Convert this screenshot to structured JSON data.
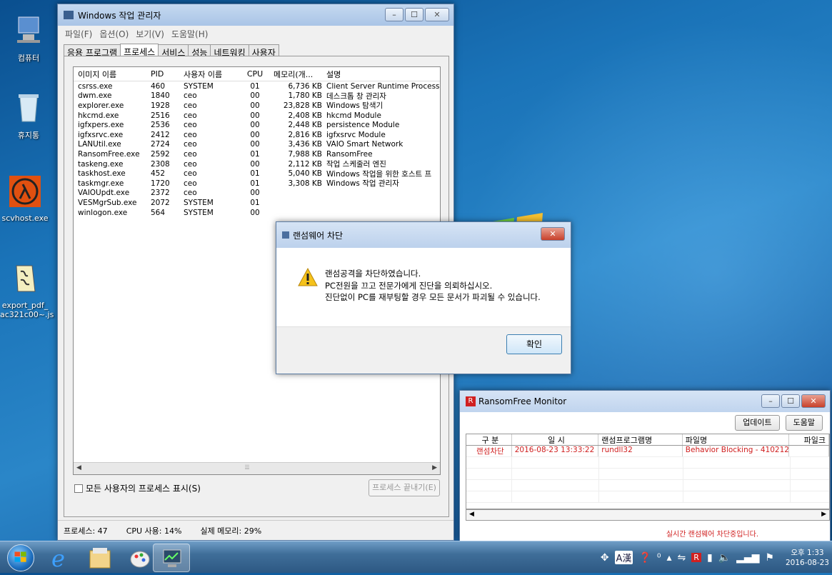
{
  "desktop": {
    "icons": [
      {
        "label": "컴퓨터",
        "icon": "computer-icon"
      },
      {
        "label": "휴지통",
        "icon": "recycle-bin-icon"
      },
      {
        "label": "scvhost.exe",
        "icon": "half-life-lambda-icon"
      },
      {
        "label": "export_pdf_\nac321c00~.js",
        "icon": "script-file-icon"
      }
    ]
  },
  "taskmgr": {
    "title": "Windows 작업 관리자",
    "menu": [
      "파일(F)",
      "옵션(O)",
      "보기(V)",
      "도움말(H)"
    ],
    "tabs": [
      "응용 프로그램",
      "프로세스",
      "서비스",
      "성능",
      "네트워킹",
      "사용자"
    ],
    "columns": [
      "이미지 이름",
      "PID",
      "사용자 이름",
      "CPU",
      "메모리(개...",
      "설명"
    ],
    "rows": [
      [
        "csrss.exe",
        "460",
        "SYSTEM",
        "01",
        "6,736 KB",
        "Client Server Runtime Process"
      ],
      [
        "dwm.exe",
        "1840",
        "ceo",
        "00",
        "1,780 KB",
        "데스크톱 창 관리자"
      ],
      [
        "explorer.exe",
        "1928",
        "ceo",
        "00",
        "23,828 KB",
        "Windows 탐색기"
      ],
      [
        "hkcmd.exe",
        "2516",
        "ceo",
        "00",
        "2,408 KB",
        "hkcmd Module"
      ],
      [
        "igfxpers.exe",
        "2536",
        "ceo",
        "00",
        "2,448 KB",
        "persistence Module"
      ],
      [
        "igfxsrvc.exe",
        "2412",
        "ceo",
        "00",
        "2,816 KB",
        "igfxsrvc Module"
      ],
      [
        "LANUtil.exe",
        "2724",
        "ceo",
        "00",
        "3,436 KB",
        "VAIO Smart Network"
      ],
      [
        "RansomFree.exe",
        "2592",
        "ceo",
        "01",
        "7,988 KB",
        "RansomFree"
      ],
      [
        "taskeng.exe",
        "2308",
        "ceo",
        "00",
        "2,112 KB",
        "작업 스케줄러 엔진"
      ],
      [
        "taskhost.exe",
        "452",
        "ceo",
        "01",
        "5,040 KB",
        "Windows 작업을 위한 호스트 프"
      ],
      [
        "taskmgr.exe",
        "1720",
        "ceo",
        "01",
        "3,308 KB",
        "Windows 작업 관리자"
      ],
      [
        "VAIOUpdt.exe",
        "2372",
        "ceo",
        "00",
        "",
        ""
      ],
      [
        "VESMgrSub.exe",
        "2072",
        "SYSTEM",
        "01",
        "",
        ""
      ],
      [
        "winlogon.exe",
        "564",
        "SYSTEM",
        "00",
        "",
        ""
      ]
    ],
    "show_all_label": "모든 사용자의 프로세스 표시(S)",
    "end_process_label": "프로세스 끝내기(E)",
    "status": {
      "processes": "프로세스: 47",
      "cpu": "CPU 사용: 14%",
      "memory": "실제 메모리: 29%"
    }
  },
  "dialog": {
    "title": "랜섬웨어 차단",
    "lines": [
      "랜섬공격을 차단하였습니다.",
      "PC전원을 끄고 전문가에게 진단을 의뢰하십시오.",
      "진단없이 PC를 재부팅할 경우 모든 문서가 파괴될 수 있습니다."
    ],
    "ok_label": "확인"
  },
  "ransomfree": {
    "title": "RansomFree Monitor",
    "update_label": "업데이트",
    "help_label": "도움말",
    "columns": [
      "구 분",
      "일 시",
      "랜섬프로그램명",
      "파일명",
      "파일크"
    ],
    "rows": [
      [
        "랜섬차단",
        "2016-08-23 13:33:22",
        "rundll32",
        "Behavior Blocking - 410212...",
        ""
      ]
    ],
    "status": "실시간 랜섬웨어 차단중입니다."
  },
  "taskbar": {
    "time": "오후 1:33",
    "date": "2016-08-23",
    "ime_label": "A漢"
  }
}
